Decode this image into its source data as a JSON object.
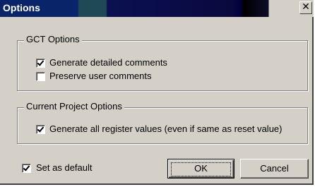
{
  "window": {
    "title": "Options",
    "close_glyph": "✕"
  },
  "gct_group": {
    "label": "GCT Options",
    "options": [
      {
        "label": "Generate detailed comments",
        "checked": true
      },
      {
        "label": "Preserve user comments",
        "checked": false
      }
    ]
  },
  "project_group": {
    "label": "Current Project Options",
    "options": [
      {
        "label": "Generate all register values (even if same as reset value)",
        "checked": true
      }
    ]
  },
  "set_default": {
    "label": "Set as default",
    "checked": true
  },
  "buttons": {
    "ok": "OK",
    "cancel": "Cancel"
  },
  "icons": {
    "close": "close-icon",
    "check": "check-icon"
  },
  "colors": {
    "titlebar": "#0a246a",
    "face": "#d4d0c8"
  }
}
